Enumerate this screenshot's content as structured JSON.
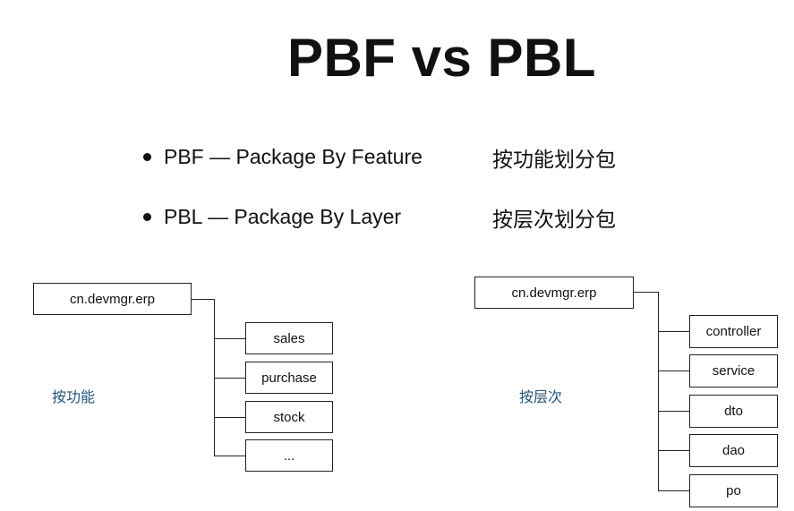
{
  "title": "PBF vs PBL",
  "bullets": [
    {
      "en": "PBF — Package By Feature",
      "cn": "按功能划分包"
    },
    {
      "en": "PBL — Package By Layer",
      "cn": "按层次划分包"
    }
  ],
  "left_tree": {
    "root": "cn.devmgr.erp",
    "caption": "按功能",
    "children": [
      "sales",
      "purchase",
      "stock",
      "..."
    ]
  },
  "right_tree": {
    "root": "cn.devmgr.erp",
    "caption": "按层次",
    "children": [
      "controller",
      "service",
      "dto",
      "dao",
      "po"
    ]
  }
}
